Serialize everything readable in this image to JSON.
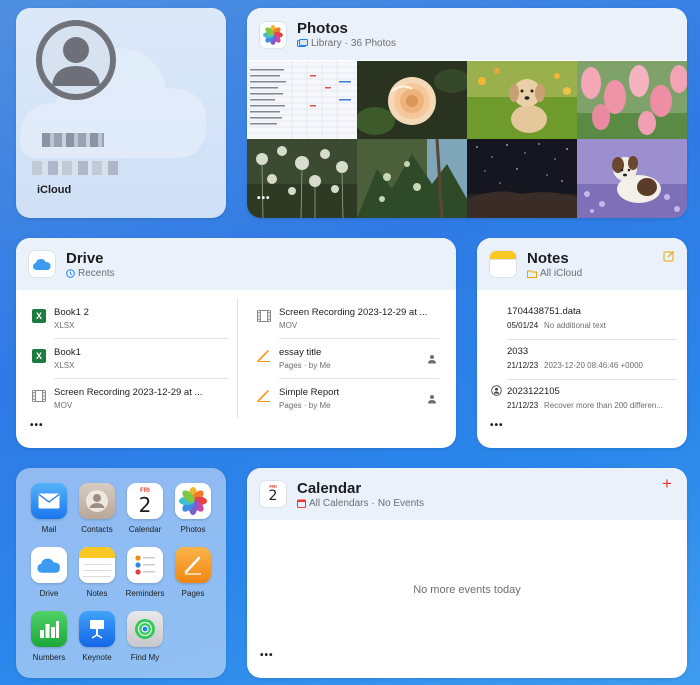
{
  "profile": {
    "label": "iCloud"
  },
  "photos": {
    "title": "Photos",
    "subtitle_library": "Library",
    "subtitle_count": "36 Photos",
    "more": "•••"
  },
  "drive": {
    "title": "Drive",
    "subtitle": "Recents",
    "more": "•••",
    "left_items": [
      {
        "name": "Book1 2",
        "meta": "XLSX",
        "icon": "excel-icon"
      },
      {
        "name": "Book1",
        "meta": "XLSX",
        "icon": "excel-icon"
      },
      {
        "name": "Screen Recording 2023-12-29 at ...",
        "meta": "MOV",
        "icon": "film-icon"
      }
    ],
    "right_items": [
      {
        "name": "Screen Recording 2023-12-29 at ...",
        "meta": "MOV",
        "icon": "film-icon"
      },
      {
        "name": "essay title",
        "meta": "Pages · by Me",
        "icon": "pages-icon"
      },
      {
        "name": "Simple Report",
        "meta": "Pages · by Me",
        "icon": "pages-icon"
      }
    ]
  },
  "notes": {
    "title": "Notes",
    "subtitle": "All iCloud",
    "more": "•••",
    "items": [
      {
        "title": "1704438751.data",
        "date": "05/01/24",
        "preview": "No additional text"
      },
      {
        "title": "2033",
        "date": "21/12/23",
        "preview": "2023-12-20 08:46:46 +0000"
      },
      {
        "title": "2023122105",
        "date": "21/12/23",
        "preview": "Recover more than 200 differen..."
      }
    ]
  },
  "apps": [
    {
      "label": "Mail",
      "icon": "mail-icon",
      "color": "#1e8cf5"
    },
    {
      "label": "Contacts",
      "icon": "contacts-icon",
      "color": "#c9b8a8"
    },
    {
      "label": "Calendar",
      "icon": "calendar-icon",
      "color": "#ffffff",
      "day": "FRI",
      "date": "2"
    },
    {
      "label": "Photos",
      "icon": "photos-icon",
      "color": "#ffffff"
    },
    {
      "label": "Drive",
      "icon": "cloud-icon",
      "color": "#ffffff"
    },
    {
      "label": "Notes",
      "icon": "notes-icon",
      "color": "#ffffff"
    },
    {
      "label": "Reminders",
      "icon": "reminders-icon",
      "color": "#ffffff"
    },
    {
      "label": "Pages",
      "icon": "pages-icon",
      "color": "#f4901e"
    },
    {
      "label": "Numbers",
      "icon": "numbers-icon",
      "color": "#2fbe4a"
    },
    {
      "label": "Keynote",
      "icon": "keynote-icon",
      "color": "#1f7ef0"
    },
    {
      "label": "Find My",
      "icon": "findmy-icon",
      "color": "#d8d8d8"
    }
  ],
  "calendar": {
    "title": "Calendar",
    "icon_day": "FRI",
    "icon_date": "2",
    "subtitle_calendars": "All Calendars",
    "subtitle_events": "No Events",
    "empty": "No more events today",
    "more": "•••",
    "add": "+"
  }
}
